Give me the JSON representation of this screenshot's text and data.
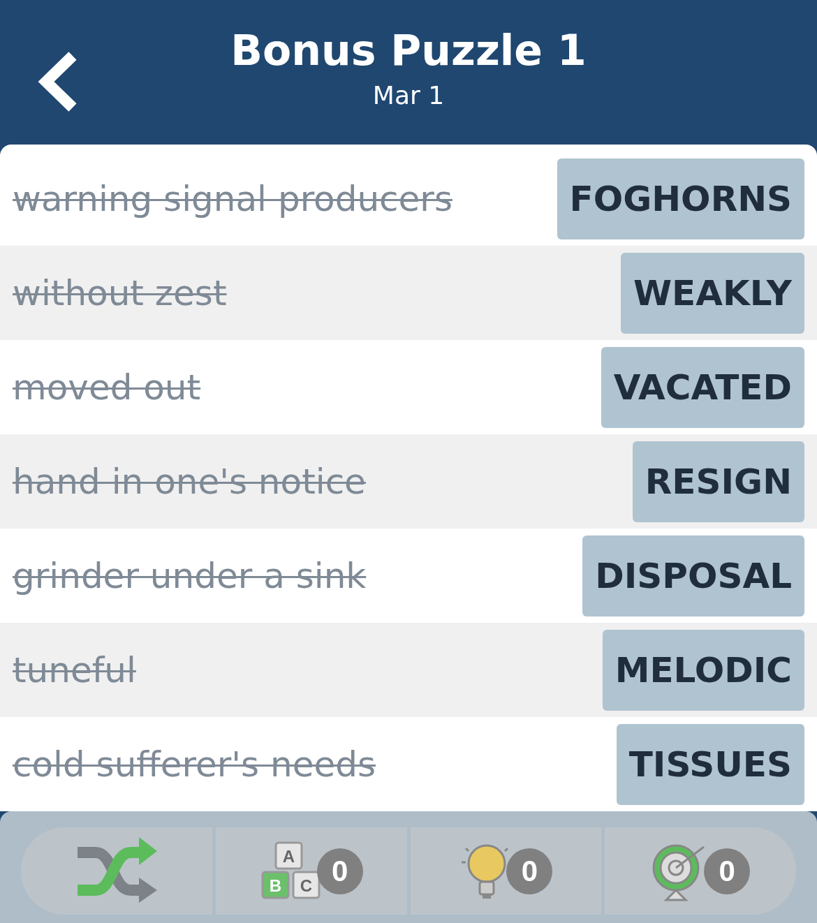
{
  "header": {
    "title": "Bonus Puzzle 1",
    "subtitle": "Mar 1"
  },
  "clues": [
    {
      "clue": "warning signal producers",
      "answer": "FOGHORNS",
      "solved": true
    },
    {
      "clue": "without zest",
      "answer": "WEAKLY",
      "solved": true
    },
    {
      "clue": "moved out",
      "answer": "VACATED",
      "solved": true
    },
    {
      "clue": "hand in one's notice",
      "answer": "RESIGN",
      "solved": true
    },
    {
      "clue": "grinder under a sink",
      "answer": "DISPOSAL",
      "solved": true
    },
    {
      "clue": "tuneful",
      "answer": "MELODIC",
      "solved": true
    },
    {
      "clue": "cold sufferer's needs",
      "answer": "TISSUES",
      "solved": true
    }
  ],
  "toolbar": [
    {
      "kind": "shuffle"
    },
    {
      "kind": "letters",
      "letters": [
        "A",
        "B",
        "C"
      ],
      "count": "0"
    },
    {
      "kind": "hint",
      "count": "0"
    },
    {
      "kind": "target",
      "count": "0"
    }
  ]
}
